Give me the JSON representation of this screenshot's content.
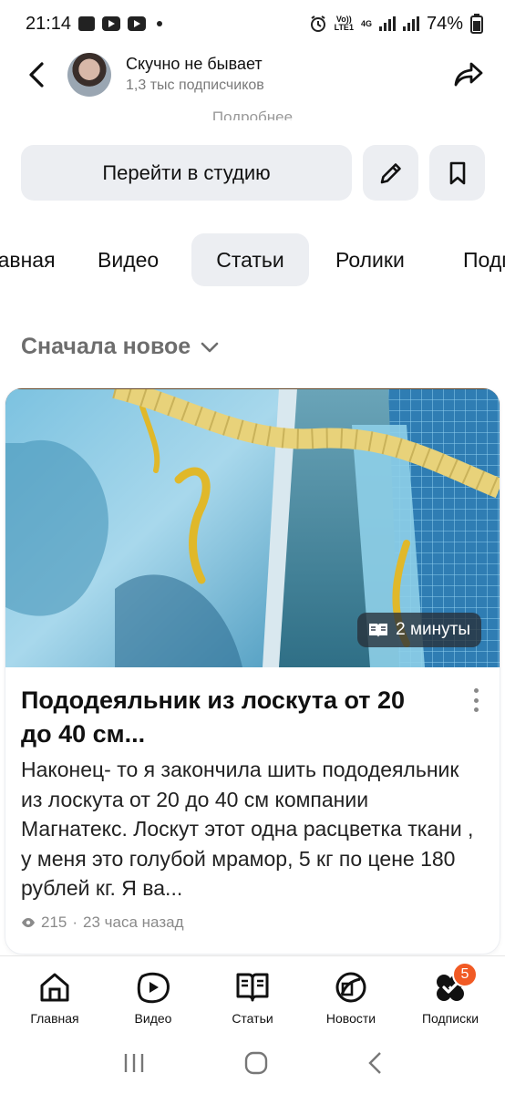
{
  "status_bar": {
    "time": "21:14",
    "network_top": "Vo))",
    "network_bottom": "LTE1",
    "network_type": "4G",
    "battery": "74%"
  },
  "header": {
    "channel_name": "Скучно не бывает",
    "subscribers": "1,3 тыс подписчиков",
    "more_link": "Подробнее"
  },
  "actions": {
    "studio_label": "Перейти в студию"
  },
  "tabs": [
    {
      "label": "Главная"
    },
    {
      "label": "Видео"
    },
    {
      "label": "Статьи"
    },
    {
      "label": "Ролики"
    },
    {
      "label": "Подписки"
    }
  ],
  "tabs_active": "Статьи",
  "sort": {
    "label": "Сначала новое"
  },
  "article": {
    "read_time": "2 минуты",
    "title": "Пододеяльник из лоскута от 20 до 40 см...",
    "snippet": "Наконец- то я закончила шить пододеяльник из лоскута от 20 до 40 см компании Магнатекс. Лоскут этот одна расцветка ткани , у меня это голубой мрамор, 5 кг по цене 180 рублей кг. Я ва...",
    "views": "215",
    "separator": "·",
    "posted": "23 часа назад"
  },
  "bottom_nav": [
    {
      "label": "Главная",
      "icon": "home-icon"
    },
    {
      "label": "Видео",
      "icon": "video-icon"
    },
    {
      "label": "Статьи",
      "icon": "articles-icon"
    },
    {
      "label": "Новости",
      "icon": "news-icon"
    },
    {
      "label": "Подписки",
      "icon": "subscriptions-icon",
      "badge": "5"
    }
  ],
  "colors": {
    "chip_bg": "#eceef2",
    "badge": "#f15a24",
    "muted": "#7a7a7a"
  }
}
